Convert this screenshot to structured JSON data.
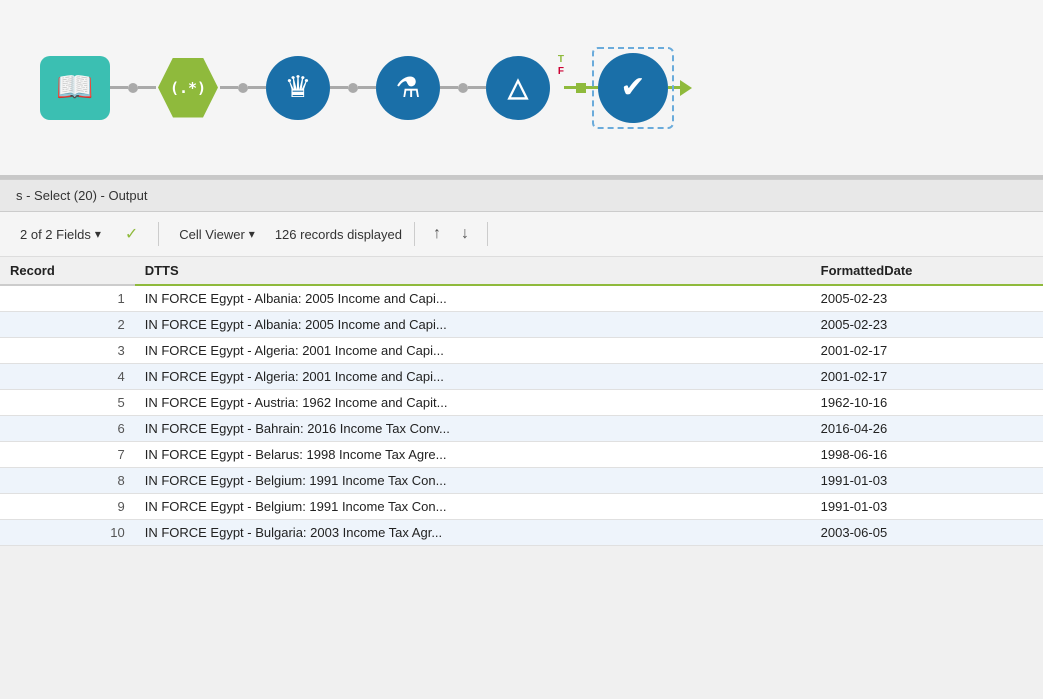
{
  "workflow": {
    "nodes": [
      {
        "id": "book",
        "type": "book",
        "icon": "📖",
        "shape": "rect"
      },
      {
        "id": "regex",
        "type": "regex",
        "icon": "(*)",
        "shape": "hex"
      },
      {
        "id": "crown",
        "type": "crown",
        "icon": "♛",
        "shape": "circle"
      },
      {
        "id": "flask",
        "type": "flask",
        "icon": "⚗",
        "shape": "circle"
      },
      {
        "id": "triangle",
        "type": "filter",
        "icon": "△",
        "shape": "circle"
      },
      {
        "id": "check",
        "type": "output",
        "icon": "✔",
        "shape": "circle-dashed"
      }
    ]
  },
  "output_header": {
    "title": "s - Select (20) - Output"
  },
  "toolbar": {
    "fields_label": "2 of 2 Fields",
    "cell_viewer_label": "Cell Viewer",
    "records_label": "126 records displayed",
    "chevron_down": "▾",
    "check_icon": "✓"
  },
  "table": {
    "columns": [
      "Record",
      "DTTS",
      "FormattedDate"
    ],
    "rows": [
      {
        "record": 1,
        "dtts": "IN FORCE Egypt - Albania: 2005 Income and Capi...",
        "formattedDate": "2005-02-23"
      },
      {
        "record": 2,
        "dtts": "IN FORCE Egypt - Albania: 2005 Income and Capi...",
        "formattedDate": "2005-02-23"
      },
      {
        "record": 3,
        "dtts": "IN FORCE Egypt - Algeria: 2001 Income and Capi...",
        "formattedDate": "2001-02-17"
      },
      {
        "record": 4,
        "dtts": "IN FORCE Egypt - Algeria: 2001 Income and Capi...",
        "formattedDate": "2001-02-17"
      },
      {
        "record": 5,
        "dtts": "IN FORCE Egypt - Austria: 1962 Income and Capit...",
        "formattedDate": "1962-10-16"
      },
      {
        "record": 6,
        "dtts": "IN FORCE Egypt - Bahrain: 2016 Income Tax Conv...",
        "formattedDate": "2016-04-26"
      },
      {
        "record": 7,
        "dtts": "IN FORCE Egypt - Belarus: 1998 Income Tax Agre...",
        "formattedDate": "1998-06-16"
      },
      {
        "record": 8,
        "dtts": "IN FORCE Egypt - Belgium: 1991 Income Tax Con...",
        "formattedDate": "1991-01-03"
      },
      {
        "record": 9,
        "dtts": "IN FORCE Egypt - Belgium: 1991 Income Tax Con...",
        "formattedDate": "1991-01-03"
      },
      {
        "record": 10,
        "dtts": "IN FORCE Egypt - Bulgaria: 2003 Income Tax Agr...",
        "formattedDate": "2003-06-05"
      }
    ]
  }
}
